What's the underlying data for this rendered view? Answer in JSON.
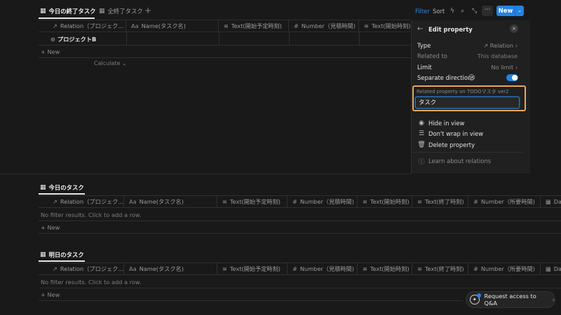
{
  "top_view": {
    "tabs": [
      {
        "label": "今日の終了タスク",
        "active": true
      },
      {
        "label": "全終了タスク",
        "active": false
      }
    ],
    "add_tab_label": "+",
    "toolbar": {
      "filter_label": "Filter",
      "sort_label": "Sort",
      "more_label": "⋯",
      "new_label": "New",
      "new_caret": "⌄"
    },
    "columns": [
      {
        "icon": "↗",
        "label": "Relation（プロジェク..."
      },
      {
        "icon": "Aa",
        "label": "Name(タスク名)"
      },
      {
        "icon": "≡",
        "label": "Text(開始予定時刻)"
      },
      {
        "icon": "#",
        "label": "Number（見積時間)"
      },
      {
        "icon": "≡",
        "label": "Text(開始時刻)"
      }
    ],
    "rows": [
      {
        "relation": "プロジェクトB"
      }
    ],
    "add_row_label": "+ New",
    "calculate_label": "Calculate ⌄"
  },
  "panel": {
    "title": "Edit property",
    "back_icon": "←",
    "close_icon": "×",
    "type_label": "Type",
    "type_value": "↗ Relation ›",
    "related_to_label": "Related to",
    "related_to_value": "This database",
    "limit_label": "Limit",
    "limit_value": "No limit ›",
    "separate_label": "Separate directions",
    "separate_on": true,
    "related_property_label": "Related property on TODOマスタ ver2",
    "related_property_value": "タスク",
    "items": [
      {
        "icon": "eye-icon",
        "label": "Hide in view"
      },
      {
        "icon": "lines-icon",
        "label": "Don't wrap in view"
      },
      {
        "icon": "trash-icon",
        "label": "Delete property"
      }
    ],
    "learn_label": "Learn about relations"
  },
  "sections": [
    {
      "title": "今日のタスク",
      "columns": [
        {
          "icon": "↗",
          "label": "Relation（プロジェク..."
        },
        {
          "icon": "Aa",
          "label": "Name(タスク名)"
        },
        {
          "icon": "≡",
          "label": "Text(開始予定時刻)"
        },
        {
          "icon": "#",
          "label": "Number（見積時間)"
        },
        {
          "icon": "≡",
          "label": "Text(開始時刻)"
        },
        {
          "icon": "≡",
          "label": "Text(終了時刻)"
        },
        {
          "icon": "#",
          "label": "Number（所要時間)"
        },
        {
          "icon": "▦",
          "label": "Dat"
        }
      ],
      "empty_label": "No filter results. Click to add a row.",
      "add_row_label": "+ New"
    },
    {
      "title": "明日のタスク",
      "columns": [
        {
          "icon": "↗",
          "label": "Relation（プロジェク..."
        },
        {
          "icon": "Aa",
          "label": "Name(タスク名)"
        },
        {
          "icon": "≡",
          "label": "Text(開始予定時刻)"
        },
        {
          "icon": "#",
          "label": "Number（見積時間)"
        },
        {
          "icon": "≡",
          "label": "Text(開始時刻)"
        },
        {
          "icon": "≡",
          "label": "Text(終了時刻)"
        },
        {
          "icon": "#",
          "label": "Number（所要時間)"
        },
        {
          "icon": "▦",
          "label": "Dat"
        }
      ],
      "empty_label": "No filter results. Click to add a row.",
      "add_row_label": "+ New"
    }
  ],
  "request_access": {
    "label": "Request access to Q&A",
    "caret": "›"
  },
  "colors": {
    "background": "#191919",
    "panel": "#202020",
    "accent": "#2383e2",
    "highlight": "#e8a75a"
  }
}
